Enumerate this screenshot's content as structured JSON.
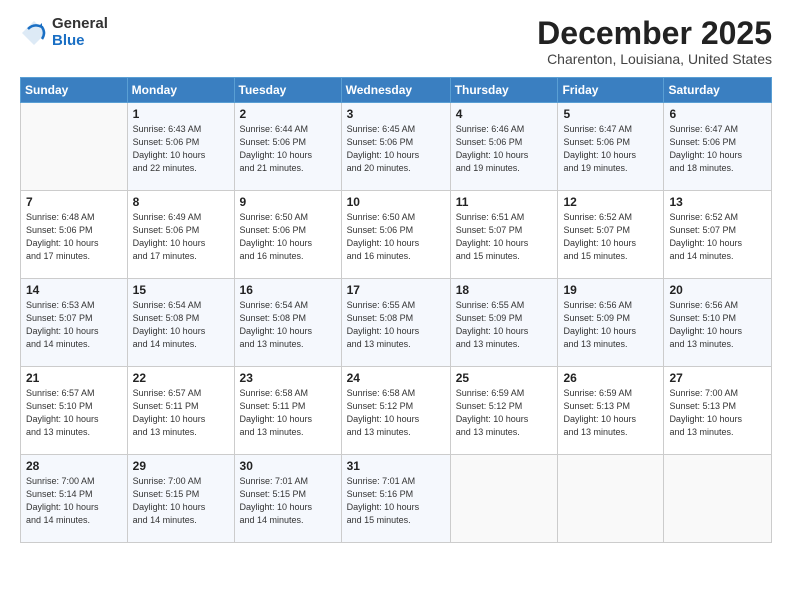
{
  "logo": {
    "general": "General",
    "blue": "Blue"
  },
  "title": "December 2025",
  "subtitle": "Charenton, Louisiana, United States",
  "days_header": [
    "Sunday",
    "Monday",
    "Tuesday",
    "Wednesday",
    "Thursday",
    "Friday",
    "Saturday"
  ],
  "weeks": [
    [
      {
        "day": "",
        "info": ""
      },
      {
        "day": "1",
        "info": "Sunrise: 6:43 AM\nSunset: 5:06 PM\nDaylight: 10 hours\nand 22 minutes."
      },
      {
        "day": "2",
        "info": "Sunrise: 6:44 AM\nSunset: 5:06 PM\nDaylight: 10 hours\nand 21 minutes."
      },
      {
        "day": "3",
        "info": "Sunrise: 6:45 AM\nSunset: 5:06 PM\nDaylight: 10 hours\nand 20 minutes."
      },
      {
        "day": "4",
        "info": "Sunrise: 6:46 AM\nSunset: 5:06 PM\nDaylight: 10 hours\nand 19 minutes."
      },
      {
        "day": "5",
        "info": "Sunrise: 6:47 AM\nSunset: 5:06 PM\nDaylight: 10 hours\nand 19 minutes."
      },
      {
        "day": "6",
        "info": "Sunrise: 6:47 AM\nSunset: 5:06 PM\nDaylight: 10 hours\nand 18 minutes."
      }
    ],
    [
      {
        "day": "7",
        "info": "Sunrise: 6:48 AM\nSunset: 5:06 PM\nDaylight: 10 hours\nand 17 minutes."
      },
      {
        "day": "8",
        "info": "Sunrise: 6:49 AM\nSunset: 5:06 PM\nDaylight: 10 hours\nand 17 minutes."
      },
      {
        "day": "9",
        "info": "Sunrise: 6:50 AM\nSunset: 5:06 PM\nDaylight: 10 hours\nand 16 minutes."
      },
      {
        "day": "10",
        "info": "Sunrise: 6:50 AM\nSunset: 5:06 PM\nDaylight: 10 hours\nand 16 minutes."
      },
      {
        "day": "11",
        "info": "Sunrise: 6:51 AM\nSunset: 5:07 PM\nDaylight: 10 hours\nand 15 minutes."
      },
      {
        "day": "12",
        "info": "Sunrise: 6:52 AM\nSunset: 5:07 PM\nDaylight: 10 hours\nand 15 minutes."
      },
      {
        "day": "13",
        "info": "Sunrise: 6:52 AM\nSunset: 5:07 PM\nDaylight: 10 hours\nand 14 minutes."
      }
    ],
    [
      {
        "day": "14",
        "info": "Sunrise: 6:53 AM\nSunset: 5:07 PM\nDaylight: 10 hours\nand 14 minutes."
      },
      {
        "day": "15",
        "info": "Sunrise: 6:54 AM\nSunset: 5:08 PM\nDaylight: 10 hours\nand 14 minutes."
      },
      {
        "day": "16",
        "info": "Sunrise: 6:54 AM\nSunset: 5:08 PM\nDaylight: 10 hours\nand 13 minutes."
      },
      {
        "day": "17",
        "info": "Sunrise: 6:55 AM\nSunset: 5:08 PM\nDaylight: 10 hours\nand 13 minutes."
      },
      {
        "day": "18",
        "info": "Sunrise: 6:55 AM\nSunset: 5:09 PM\nDaylight: 10 hours\nand 13 minutes."
      },
      {
        "day": "19",
        "info": "Sunrise: 6:56 AM\nSunset: 5:09 PM\nDaylight: 10 hours\nand 13 minutes."
      },
      {
        "day": "20",
        "info": "Sunrise: 6:56 AM\nSunset: 5:10 PM\nDaylight: 10 hours\nand 13 minutes."
      }
    ],
    [
      {
        "day": "21",
        "info": "Sunrise: 6:57 AM\nSunset: 5:10 PM\nDaylight: 10 hours\nand 13 minutes."
      },
      {
        "day": "22",
        "info": "Sunrise: 6:57 AM\nSunset: 5:11 PM\nDaylight: 10 hours\nand 13 minutes."
      },
      {
        "day": "23",
        "info": "Sunrise: 6:58 AM\nSunset: 5:11 PM\nDaylight: 10 hours\nand 13 minutes."
      },
      {
        "day": "24",
        "info": "Sunrise: 6:58 AM\nSunset: 5:12 PM\nDaylight: 10 hours\nand 13 minutes."
      },
      {
        "day": "25",
        "info": "Sunrise: 6:59 AM\nSunset: 5:12 PM\nDaylight: 10 hours\nand 13 minutes."
      },
      {
        "day": "26",
        "info": "Sunrise: 6:59 AM\nSunset: 5:13 PM\nDaylight: 10 hours\nand 13 minutes."
      },
      {
        "day": "27",
        "info": "Sunrise: 7:00 AM\nSunset: 5:13 PM\nDaylight: 10 hours\nand 13 minutes."
      }
    ],
    [
      {
        "day": "28",
        "info": "Sunrise: 7:00 AM\nSunset: 5:14 PM\nDaylight: 10 hours\nand 14 minutes."
      },
      {
        "day": "29",
        "info": "Sunrise: 7:00 AM\nSunset: 5:15 PM\nDaylight: 10 hours\nand 14 minutes."
      },
      {
        "day": "30",
        "info": "Sunrise: 7:01 AM\nSunset: 5:15 PM\nDaylight: 10 hours\nand 14 minutes."
      },
      {
        "day": "31",
        "info": "Sunrise: 7:01 AM\nSunset: 5:16 PM\nDaylight: 10 hours\nand 15 minutes."
      },
      {
        "day": "",
        "info": ""
      },
      {
        "day": "",
        "info": ""
      },
      {
        "day": "",
        "info": ""
      }
    ]
  ]
}
